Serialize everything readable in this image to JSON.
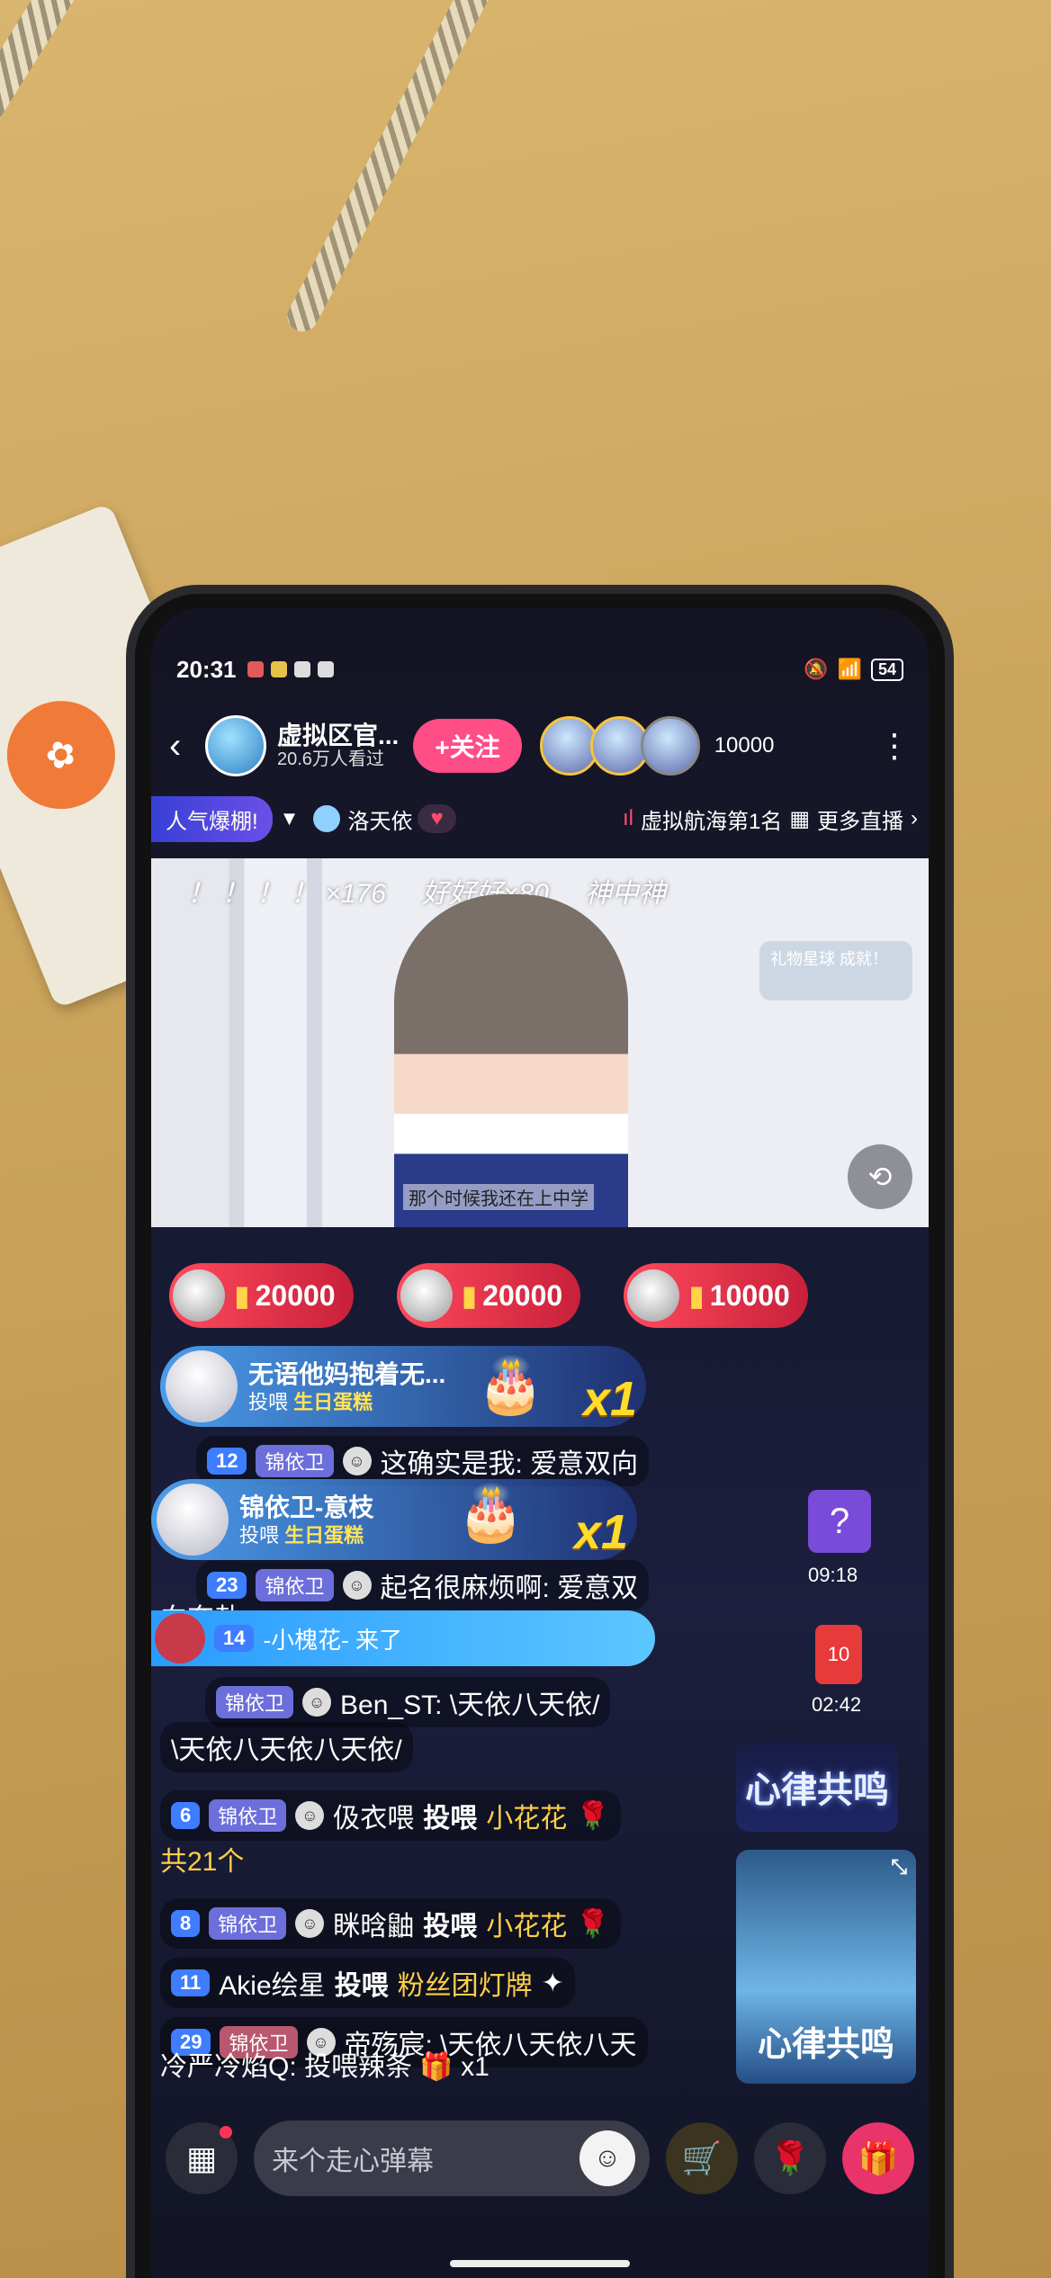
{
  "status": {
    "time": "20:31",
    "battery": "54"
  },
  "header": {
    "anchor_name": "虚拟区官...",
    "viewers_text": "20.6万人看过",
    "follow_label": "+关注",
    "online_count": "10000"
  },
  "tags": {
    "hot_label": "人气爆棚!",
    "anchor_tag": "洛天依",
    "rank": "虚拟航海第1名",
    "more_live": "更多直播"
  },
  "video": {
    "bullets": [
      "！ ！ ！ ！ ×176",
      "好好好×80",
      "神中神"
    ],
    "gift_widget_text": "礼物星球 成就！",
    "caption": "那个时候我还在上中学"
  },
  "pk": [
    {
      "value": "20000"
    },
    {
      "value": "20000"
    },
    {
      "value": "10000"
    }
  ],
  "gifts": [
    {
      "user": "无语他妈抱着无...",
      "action": "投喂",
      "gift": "生日蛋糕",
      "count": "x1"
    },
    {
      "user": "锦依卫-意枝",
      "action": "投喂",
      "gift": "生日蛋糕",
      "count": "x1"
    }
  ],
  "chat": {
    "line1": {
      "level": "12",
      "fan": "锦依卫",
      "text": "这确实是我: 爱意双向"
    },
    "line2": {
      "level": "23",
      "fan": "锦依卫",
      "text": "起名很麻烦啊: 爱意双"
    },
    "line2b": "向奔赴",
    "enter": {
      "level": "14",
      "text": "-小槐花- 来了"
    },
    "line3": {
      "fan": "锦依卫",
      "text": "Ben_ST: \\天依八天依/"
    },
    "line3b": "\\天依八天依八天依/",
    "line4": {
      "level": "6",
      "fan": "锦依卫",
      "user": "伋衣喂",
      "action": "投喂",
      "gift": "小花花"
    },
    "line4b": "共21个",
    "line5": {
      "level": "8",
      "fan": "锦依卫",
      "user": "眯晗鼬",
      "action": "投喂",
      "gift": "小花花"
    },
    "line6": {
      "level": "11",
      "user": "Akie绘星",
      "action": "投喂",
      "gift": "粉丝团灯牌"
    },
    "line7": {
      "level": "29",
      "fan": "锦依卫",
      "text": "帝殇宸: \\天依八天依八天"
    },
    "line8": {
      "user": "冷严冷焰Q:",
      "action": "投喂辣条",
      "count": "x1"
    }
  },
  "side": {
    "timer1": "09:18",
    "redpacket_badge": "10",
    "timer2": "02:42",
    "banner": "心律共鸣",
    "poster": "心律共鸣"
  },
  "bottom": {
    "input_placeholder": "来个走心弹幕"
  },
  "colors": {
    "follow": "#ff4d87",
    "pk_red": "#ff4a5d",
    "gold": "#ffcf4a"
  }
}
